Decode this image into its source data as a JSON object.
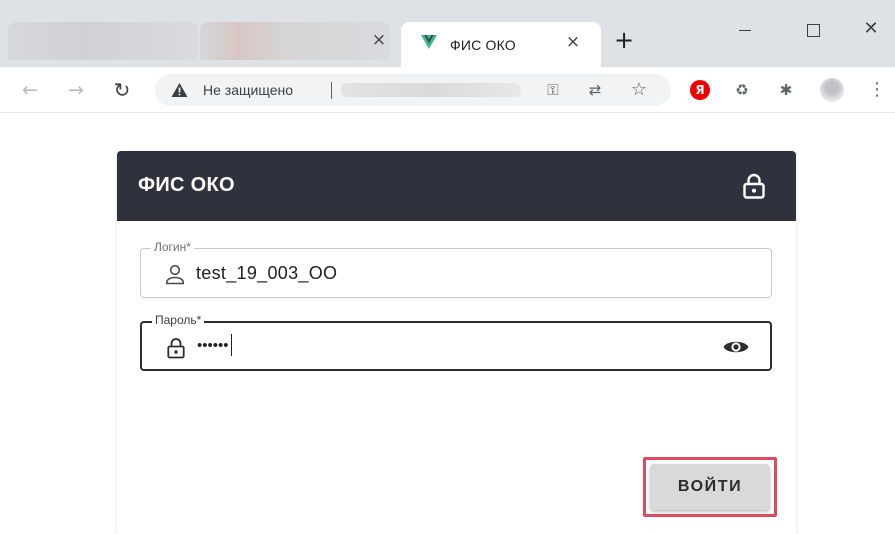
{
  "browser": {
    "active_tab": {
      "title": "ФИС ОКО",
      "icon": "vue-logo-icon"
    },
    "tab_close_glyph": "×",
    "new_tab_glyph": "+",
    "window_controls": {
      "close_glyph": "✕"
    },
    "address_bar": {
      "security_text": "Не защищено"
    },
    "extensions": {
      "yandex_label": "Я"
    }
  },
  "app": {
    "title": "ФИС ОКО",
    "login_field": {
      "label": "Логин*",
      "value": "test_19_003_OO"
    },
    "password_field": {
      "label": "Пароль*",
      "value": "••••••"
    },
    "submit_button": {
      "label": "ВОЙТИ"
    }
  },
  "colors": {
    "header_bg": "#2f313c",
    "highlight_border": "#e04a5c",
    "button_bg": "#d8d9d8",
    "vue_green": "#41b883",
    "vue_dark": "#35495e"
  }
}
